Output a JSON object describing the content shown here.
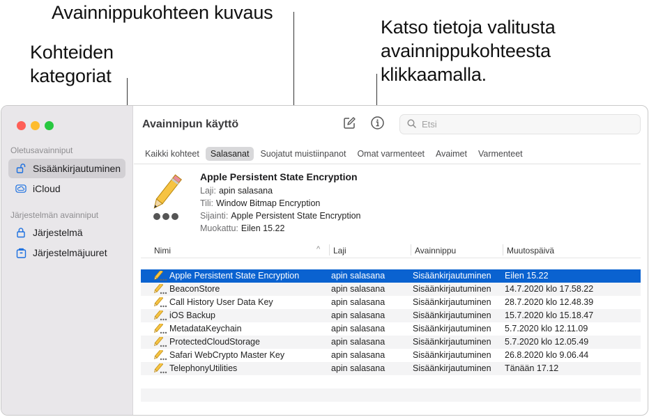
{
  "callouts": {
    "description": "Avainnippukohteen kuvaus",
    "categories_l1": "Kohteiden",
    "categories_l2": "kategoriat",
    "info_l1": "Katso tietoja valitusta",
    "info_l2": "avainnippukohteesta",
    "info_l3": "klikkaamalla."
  },
  "window": {
    "title": "Avainnipun käyttö",
    "search_placeholder": "Etsi"
  },
  "sidebar": {
    "default_header": "Oletusavainniput",
    "default_items": [
      {
        "label": "Sisäänkirjautuminen",
        "icon": "lock-open-icon",
        "active": true
      },
      {
        "label": "iCloud",
        "icon": "cloud-icon",
        "active": false
      }
    ],
    "system_header": "Järjestelmän avainniput",
    "system_items": [
      {
        "label": "Järjestelmä",
        "icon": "lock-icon"
      },
      {
        "label": "Järjestelmäjuuret",
        "icon": "cabinet-icon"
      }
    ]
  },
  "tabs": [
    "Kaikki kohteet",
    "Salasanat",
    "Suojatut muistiinpanot",
    "Omat varmenteet",
    "Avaimet",
    "Varmenteet"
  ],
  "active_tab": "Salasanat",
  "detail": {
    "title": "Apple Persistent State Encryption",
    "kind_label": "Laji:",
    "kind_value": "apin salasana",
    "account_label": "Tili:",
    "account_value": "Window Bitmap Encryption",
    "where_label": "Sijainti:",
    "where_value": "Apple Persistent State Encryption",
    "modified_label": "Muokattu:",
    "modified_value": "Eilen 15.22"
  },
  "columns": {
    "name": "Nimi",
    "sort_glyph": "^",
    "kind": "Laji",
    "keychain": "Avainnippu",
    "modified": "Muutospäivä"
  },
  "rows": [
    {
      "name": "Apple Persistent State Encryption",
      "kind": "apin salasana",
      "keychain": "Sisäänkirjautuminen",
      "modified": "Eilen 15.22"
    },
    {
      "name": "BeaconStore",
      "kind": "apin salasana",
      "keychain": "Sisäänkirjautuminen",
      "modified": "14.7.2020 klo 17.58.22"
    },
    {
      "name": "Call History User Data Key",
      "kind": "apin salasana",
      "keychain": "Sisäänkirjautuminen",
      "modified": "28.7.2020 klo 12.48.39"
    },
    {
      "name": "iOS Backup",
      "kind": "apin salasana",
      "keychain": "Sisäänkirjautuminen",
      "modified": "15.7.2020 klo 15.18.47"
    },
    {
      "name": "MetadataKeychain",
      "kind": "apin salasana",
      "keychain": "Sisäänkirjautuminen",
      "modified": "5.7.2020 klo 12.11.09"
    },
    {
      "name": "ProtectedCloudStorage",
      "kind": "apin salasana",
      "keychain": "Sisäänkirjautuminen",
      "modified": "5.7.2020 klo 12.05.49"
    },
    {
      "name": "Safari WebCrypto Master Key",
      "kind": "apin salasana",
      "keychain": "Sisäänkirjautuminen",
      "modified": "26.8.2020 klo 9.06.44"
    },
    {
      "name": "TelephonyUtilities",
      "kind": "apin salasana",
      "keychain": "Sisäänkirjautuminen",
      "modified": "Tänään 17.12"
    }
  ],
  "selected_row": 0,
  "colors": {
    "selection": "#0a62d0",
    "sidebar": "#e9e7ea",
    "accent": "#0a62d0"
  }
}
